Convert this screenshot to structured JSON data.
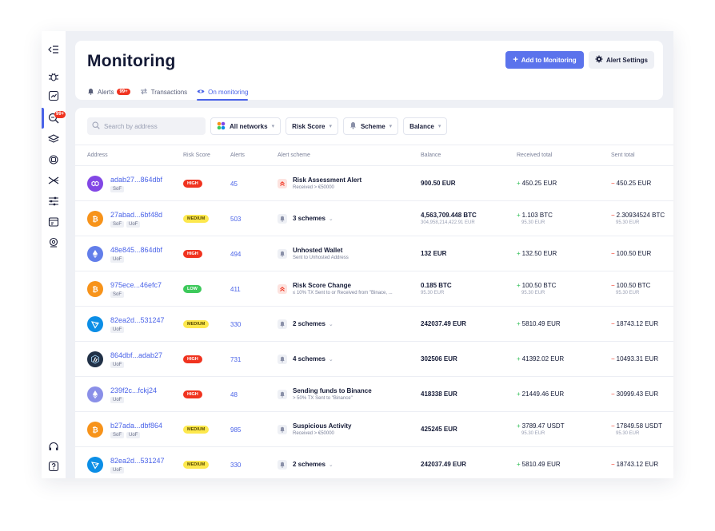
{
  "page": {
    "title": "Monitoring"
  },
  "header": {
    "add_button": "Add to Monitoring",
    "settings_button": "Alert Settings",
    "tabs": [
      {
        "label": "Alerts",
        "badge": "99+"
      },
      {
        "label": "Transactions"
      },
      {
        "label": "On monitoring"
      }
    ]
  },
  "sidebar": {
    "badge": "99+"
  },
  "filters": {
    "search_placeholder": "Search by address",
    "networks": "All networks",
    "risk_score": "Risk Score",
    "scheme": "Scheme",
    "balance": "Balance"
  },
  "table": {
    "headers": [
      "Address",
      "Risk Score",
      "Alerts",
      "Alert scheme",
      "Balance",
      "Received total",
      "Sent total"
    ],
    "rows": [
      {
        "coin": "polygon",
        "coin_color": "#8247e5",
        "address": "adab27...864dbf",
        "tags": [
          "SoF"
        ],
        "risk": "HIGH",
        "alerts": "45",
        "scheme_icon": "red",
        "scheme_title": "Risk Assessment Alert",
        "scheme_sub": "Received > €50000",
        "balance": "900.50 EUR",
        "balance_sub": "",
        "received": "450.25 EUR",
        "received_sub": "",
        "sent": "450.25 EUR",
        "sent_sub": ""
      },
      {
        "coin": "bitcoin",
        "coin_color": "#f7931a",
        "address": "27abad...6bf48d",
        "tags": [
          "SoF",
          "UoF"
        ],
        "risk": "MEDIUM",
        "alerts": "503",
        "scheme_icon": "gray",
        "scheme_title": "3 schemes",
        "scheme_sub": "",
        "balance": "4,563,709.448 BTC",
        "balance_sub": "304,958,214,422.91 EUR",
        "received": "1.103 BTC",
        "received_sub": "95.30 EUR",
        "sent": "2.30934524 BTC",
        "sent_sub": "95.30 EUR"
      },
      {
        "coin": "ethereum",
        "coin_color": "#627eea",
        "address": "48e845...864dbf",
        "tags": [
          "UoF"
        ],
        "risk": "HIGH",
        "alerts": "494",
        "scheme_icon": "gray",
        "scheme_title": "Unhosted Wallet",
        "scheme_sub": "Sent to Unhosted Address",
        "balance": "132 EUR",
        "balance_sub": "",
        "received": "132.50 EUR",
        "received_sub": "",
        "sent": "100.50 EUR",
        "sent_sub": ""
      },
      {
        "coin": "bitcoin",
        "coin_color": "#f7931a",
        "address": "975ece...46efc7",
        "tags": [
          "SoF"
        ],
        "risk": "LOW",
        "alerts": "411",
        "scheme_icon": "red",
        "scheme_title": "Risk Score Change",
        "scheme_sub": "≤ 10% TX Sent to or Received from \"Binace, ...",
        "balance": "0.185 BTC",
        "balance_sub": "95.30 EUR",
        "received": "100.50 BTC",
        "received_sub": "95.30 EUR",
        "sent": "100.50 BTC",
        "sent_sub": "95.30 EUR"
      },
      {
        "coin": "tron",
        "coin_color": "#0b8ee6",
        "address": "82ea2d...531247",
        "tags": [
          "UoF"
        ],
        "risk": "MEDIUM",
        "alerts": "330",
        "scheme_icon": "gray",
        "scheme_title": "2 schemes",
        "scheme_sub": "",
        "balance": "242037.49 EUR",
        "balance_sub": "",
        "received": "5810.49 EUR",
        "received_sub": "",
        "sent": "18743.12 EUR",
        "sent_sub": ""
      },
      {
        "coin": "arbitrum",
        "coin_color": "#213147",
        "address": "864dbf...adab27",
        "tags": [
          "UoF"
        ],
        "risk": "HIGH",
        "alerts": "731",
        "scheme_icon": "gray",
        "scheme_title": "4 schemes",
        "scheme_sub": "",
        "balance": "302506 EUR",
        "balance_sub": "",
        "received": "41392.02 EUR",
        "received_sub": "",
        "sent": "10493.31 EUR",
        "sent_sub": ""
      },
      {
        "coin": "ethereum",
        "coin_color": "#8a8fe8",
        "address": "239f2c...fckj24",
        "tags": [
          "UoF"
        ],
        "risk": "HIGH",
        "alerts": "48",
        "scheme_icon": "gray",
        "scheme_title": "Sending funds to Binance",
        "scheme_sub": "> 50% TX Sent to \"Binance\"",
        "balance": "418338 EUR",
        "balance_sub": "",
        "received": "21449.46 EUR",
        "received_sub": "",
        "sent": "30999.43 EUR",
        "sent_sub": ""
      },
      {
        "coin": "bitcoin",
        "coin_color": "#f7931a",
        "address": "b27ada...dbf864",
        "tags": [
          "SoF",
          "UoF"
        ],
        "risk": "MEDIUM",
        "alerts": "985",
        "scheme_icon": "gray",
        "scheme_title": "Suspicious Activity",
        "scheme_sub": "Received > €50000",
        "balance": "425245 EUR",
        "balance_sub": "",
        "received": "3789.47 USDT",
        "received_sub": "95.30 EUR",
        "sent": "17849.58 USDT",
        "sent_sub": "95.30 EUR"
      },
      {
        "coin": "tron",
        "coin_color": "#0b8ee6",
        "address": "82ea2d...531247",
        "tags": [
          "UoF"
        ],
        "risk": "MEDIUM",
        "alerts": "330",
        "scheme_icon": "gray",
        "scheme_title": "2 schemes",
        "scheme_sub": "",
        "balance": "242037.49 EUR",
        "balance_sub": "",
        "received": "5810.49 EUR",
        "received_sub": "",
        "sent": "18743.12 EUR",
        "sent_sub": ""
      }
    ]
  },
  "colors": {
    "accent": "#4a63e8",
    "danger": "#f0331f",
    "success": "#2fbf55",
    "warning": "#fde84d"
  }
}
